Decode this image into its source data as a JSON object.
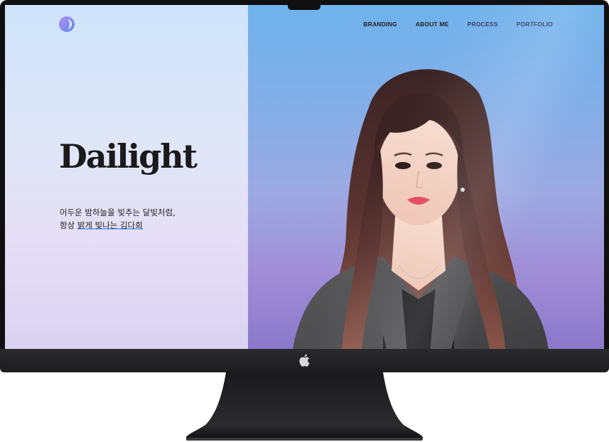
{
  "site": {
    "brand_title": "Dailight",
    "tagline_line1": "어두운 밤하늘을 빛추는 달빛처럼,",
    "tagline_line2_prefix": "항상 ",
    "tagline_line2_highlight": "밝게 빛나는 김다희",
    "nav": [
      {
        "label": "BRANDING",
        "color": "#222222"
      },
      {
        "label": "ABOUT ME",
        "color": "#222222"
      },
      {
        "label": "PROCESS",
        "color": "#2c3e66"
      },
      {
        "label": "PORTFOLIO",
        "color": "#2c3e66"
      }
    ],
    "logo_icon": "gradient-circle-logo-icon",
    "portrait_icon": "woman-portrait-image"
  },
  "device": {
    "type": "imac-monitor",
    "badge_icon": "apple-logo-icon"
  },
  "colors": {
    "left_panel_top": "#cfe3fa",
    "left_panel_bottom": "#d9d3f1",
    "right_panel_top": "#6fb2ec",
    "right_panel_bottom": "#8a78cc",
    "bezel": "#0f0f10",
    "highlight_underline": "#7aa7ee"
  }
}
